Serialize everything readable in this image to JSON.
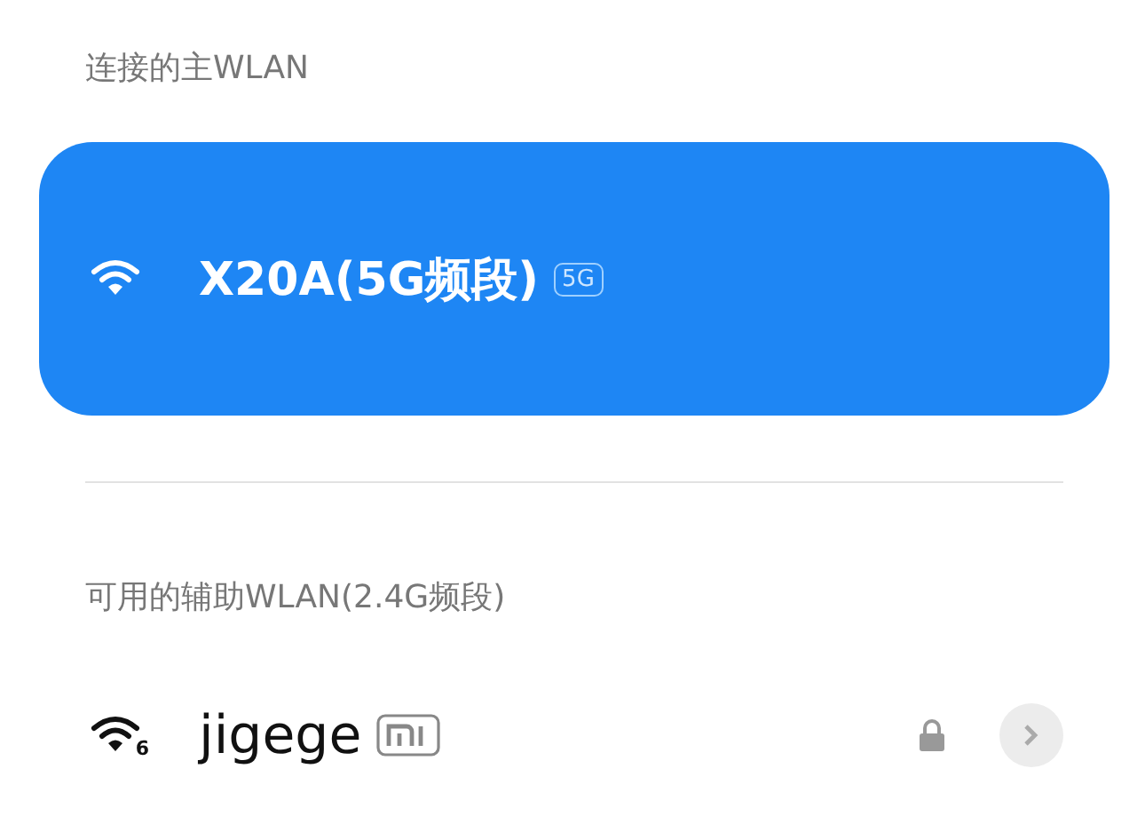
{
  "primary_section": {
    "title": "连接的主WLAN",
    "network": {
      "name": "X20A(5G频段)",
      "band_badge": "5G",
      "connected": true
    }
  },
  "secondary_section": {
    "title": "可用的辅助WLAN(2.4G频段)",
    "networks": [
      {
        "name": "jigege",
        "wifi_standard": "6",
        "secured": true,
        "connected": false
      }
    ]
  }
}
